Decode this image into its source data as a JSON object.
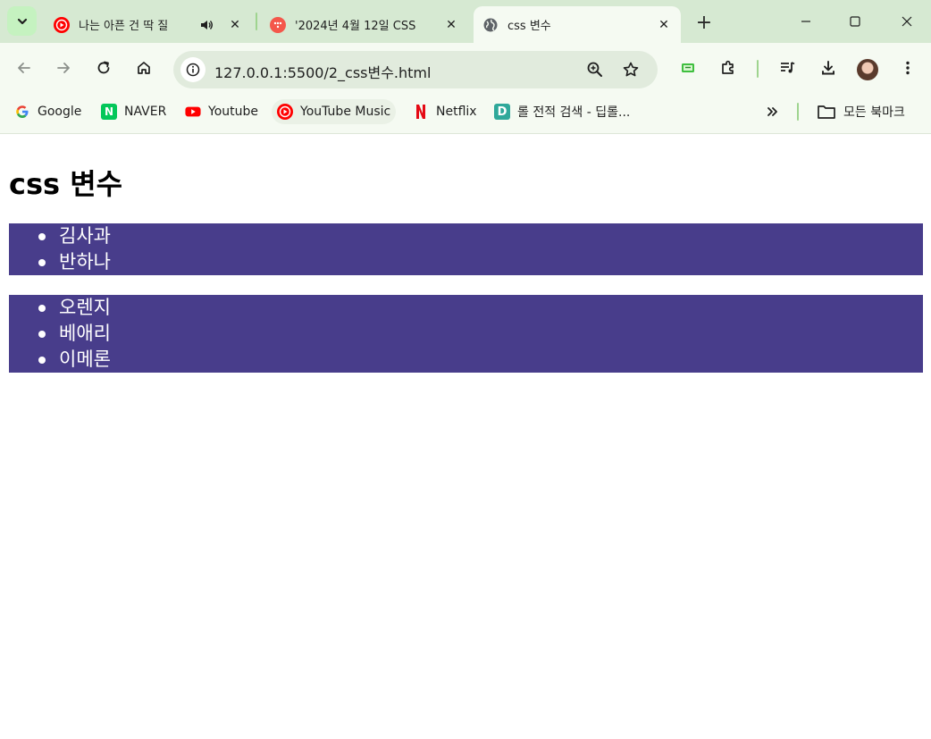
{
  "tabs": [
    {
      "title": "나는 아픈 건 딱 질",
      "active": false,
      "audio": true
    },
    {
      "title": "'2024년 4월 12일 CSS",
      "active": false,
      "audio": false
    },
    {
      "title": "css 변수",
      "active": true,
      "audio": false
    }
  ],
  "address_bar": {
    "url": "127.0.0.1:5500/2_css변수.html"
  },
  "bookmarks": [
    {
      "label": "Google",
      "icon": "google-icon"
    },
    {
      "label": "NAVER",
      "icon": "naver-icon"
    },
    {
      "label": "Youtube",
      "icon": "youtube-icon"
    },
    {
      "label": "YouTube Music",
      "icon": "youtube-music-icon"
    },
    {
      "label": "Netflix",
      "icon": "netflix-icon"
    },
    {
      "label": "롤 전적 검색 - 딥롤...",
      "icon": "deeplol-icon"
    }
  ],
  "bookmarks_folder": {
    "label": "모든 북마크"
  },
  "page": {
    "heading": "css 변수",
    "list1": [
      "김사과",
      "반하나"
    ],
    "list2": [
      "오렌지",
      "베애리",
      "이메론"
    ]
  },
  "colors": {
    "list_background": "#483d8b",
    "tabstrip": "#d6e9d2",
    "toolbar": "#f5faf2"
  }
}
